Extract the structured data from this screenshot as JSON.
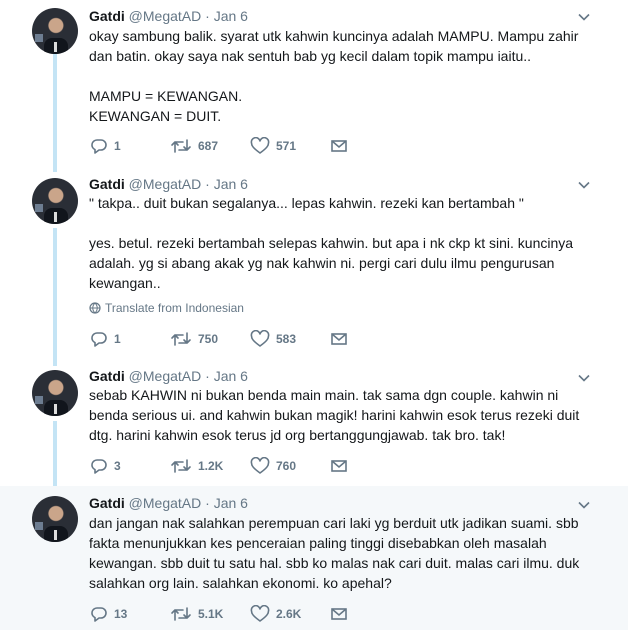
{
  "tweets": [
    {
      "name": "Gatdi",
      "handle": "@MegatAD",
      "separator": "·",
      "date": "Jan 6",
      "text": "okay sambung balik. syarat utk kahwin kuncinya adalah MAMPU. Mampu zahir\ndan batin. okay saya nak sentuh bab yg kecil dalam topik mampu iaitu..\n\nMAMPU = KEWANGAN.\nKEWANGAN = DUIT.",
      "replies": "1",
      "retweets": "687",
      "likes": "571"
    },
    {
      "name": "Gatdi",
      "handle": "@MegatAD",
      "separator": "·",
      "date": "Jan 6",
      "text": "\" takpa.. duit bukan segalanya... lepas kahwin. rezeki kan bertambah \"\n\nyes. betul. rezeki bertambah selepas kahwin. but apa i nk ckp kt sini. kuncinya\nadalah. yg si abang akak yg nak kahwin ni. pergi cari dulu ilmu pengurusan\nkewangan..",
      "translate": "Translate from Indonesian",
      "replies": "1",
      "retweets": "750",
      "likes": "583"
    },
    {
      "name": "Gatdi",
      "handle": "@MegatAD",
      "separator": "·",
      "date": "Jan 6",
      "text": "sebab KAHWIN ni bukan benda main main. tak sama dgn couple. kahwin ni\nbenda serious ui. and kahwin bukan magik! harini kahwin esok terus rezeki duit\ndtg. harini kahwin esok terus jd org bertanggungjawab. tak bro. tak!",
      "replies": "3",
      "retweets": "1.2K",
      "likes": "760"
    },
    {
      "name": "Gatdi",
      "handle": "@MegatAD",
      "separator": "·",
      "date": "Jan 6",
      "text": "dan jangan nak salahkan perempuan cari laki yg berduit utk jadikan suami. sbb\nfakta menunjukkan kes penceraian paling tinggi disebabkan oleh masalah\nkewangan. sbb duit tu satu hal. sbb ko malas nak cari duit. malas cari ilmu. duk\nsalahkan org lain. salahkan ekonomi. ko apehal?",
      "replies": "13",
      "retweets": "5.1K",
      "likes": "2.6K"
    }
  ],
  "colors": {
    "thread_line": "#c4e4f5",
    "secondary_text": "#657786",
    "highlight_bg": "#f5f8fa"
  }
}
